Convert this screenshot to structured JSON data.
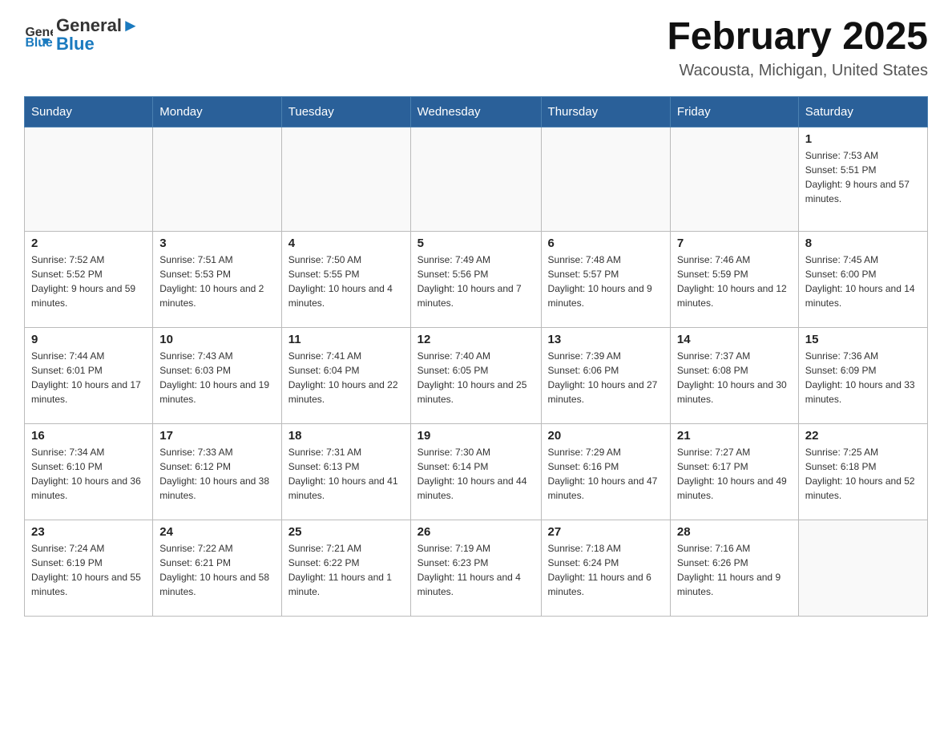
{
  "header": {
    "logo_general": "General",
    "logo_blue": "Blue",
    "title": "February 2025",
    "subtitle": "Wacousta, Michigan, United States"
  },
  "days_of_week": [
    "Sunday",
    "Monday",
    "Tuesday",
    "Wednesday",
    "Thursday",
    "Friday",
    "Saturday"
  ],
  "weeks": [
    [
      {
        "day": "",
        "info": ""
      },
      {
        "day": "",
        "info": ""
      },
      {
        "day": "",
        "info": ""
      },
      {
        "day": "",
        "info": ""
      },
      {
        "day": "",
        "info": ""
      },
      {
        "day": "",
        "info": ""
      },
      {
        "day": "1",
        "info": "Sunrise: 7:53 AM\nSunset: 5:51 PM\nDaylight: 9 hours and 57 minutes."
      }
    ],
    [
      {
        "day": "2",
        "info": "Sunrise: 7:52 AM\nSunset: 5:52 PM\nDaylight: 9 hours and 59 minutes."
      },
      {
        "day": "3",
        "info": "Sunrise: 7:51 AM\nSunset: 5:53 PM\nDaylight: 10 hours and 2 minutes."
      },
      {
        "day": "4",
        "info": "Sunrise: 7:50 AM\nSunset: 5:55 PM\nDaylight: 10 hours and 4 minutes."
      },
      {
        "day": "5",
        "info": "Sunrise: 7:49 AM\nSunset: 5:56 PM\nDaylight: 10 hours and 7 minutes."
      },
      {
        "day": "6",
        "info": "Sunrise: 7:48 AM\nSunset: 5:57 PM\nDaylight: 10 hours and 9 minutes."
      },
      {
        "day": "7",
        "info": "Sunrise: 7:46 AM\nSunset: 5:59 PM\nDaylight: 10 hours and 12 minutes."
      },
      {
        "day": "8",
        "info": "Sunrise: 7:45 AM\nSunset: 6:00 PM\nDaylight: 10 hours and 14 minutes."
      }
    ],
    [
      {
        "day": "9",
        "info": "Sunrise: 7:44 AM\nSunset: 6:01 PM\nDaylight: 10 hours and 17 minutes."
      },
      {
        "day": "10",
        "info": "Sunrise: 7:43 AM\nSunset: 6:03 PM\nDaylight: 10 hours and 19 minutes."
      },
      {
        "day": "11",
        "info": "Sunrise: 7:41 AM\nSunset: 6:04 PM\nDaylight: 10 hours and 22 minutes."
      },
      {
        "day": "12",
        "info": "Sunrise: 7:40 AM\nSunset: 6:05 PM\nDaylight: 10 hours and 25 minutes."
      },
      {
        "day": "13",
        "info": "Sunrise: 7:39 AM\nSunset: 6:06 PM\nDaylight: 10 hours and 27 minutes."
      },
      {
        "day": "14",
        "info": "Sunrise: 7:37 AM\nSunset: 6:08 PM\nDaylight: 10 hours and 30 minutes."
      },
      {
        "day": "15",
        "info": "Sunrise: 7:36 AM\nSunset: 6:09 PM\nDaylight: 10 hours and 33 minutes."
      }
    ],
    [
      {
        "day": "16",
        "info": "Sunrise: 7:34 AM\nSunset: 6:10 PM\nDaylight: 10 hours and 36 minutes."
      },
      {
        "day": "17",
        "info": "Sunrise: 7:33 AM\nSunset: 6:12 PM\nDaylight: 10 hours and 38 minutes."
      },
      {
        "day": "18",
        "info": "Sunrise: 7:31 AM\nSunset: 6:13 PM\nDaylight: 10 hours and 41 minutes."
      },
      {
        "day": "19",
        "info": "Sunrise: 7:30 AM\nSunset: 6:14 PM\nDaylight: 10 hours and 44 minutes."
      },
      {
        "day": "20",
        "info": "Sunrise: 7:29 AM\nSunset: 6:16 PM\nDaylight: 10 hours and 47 minutes."
      },
      {
        "day": "21",
        "info": "Sunrise: 7:27 AM\nSunset: 6:17 PM\nDaylight: 10 hours and 49 minutes."
      },
      {
        "day": "22",
        "info": "Sunrise: 7:25 AM\nSunset: 6:18 PM\nDaylight: 10 hours and 52 minutes."
      }
    ],
    [
      {
        "day": "23",
        "info": "Sunrise: 7:24 AM\nSunset: 6:19 PM\nDaylight: 10 hours and 55 minutes."
      },
      {
        "day": "24",
        "info": "Sunrise: 7:22 AM\nSunset: 6:21 PM\nDaylight: 10 hours and 58 minutes."
      },
      {
        "day": "25",
        "info": "Sunrise: 7:21 AM\nSunset: 6:22 PM\nDaylight: 11 hours and 1 minute."
      },
      {
        "day": "26",
        "info": "Sunrise: 7:19 AM\nSunset: 6:23 PM\nDaylight: 11 hours and 4 minutes."
      },
      {
        "day": "27",
        "info": "Sunrise: 7:18 AM\nSunset: 6:24 PM\nDaylight: 11 hours and 6 minutes."
      },
      {
        "day": "28",
        "info": "Sunrise: 7:16 AM\nSunset: 6:26 PM\nDaylight: 11 hours and 9 minutes."
      },
      {
        "day": "",
        "info": ""
      }
    ]
  ]
}
